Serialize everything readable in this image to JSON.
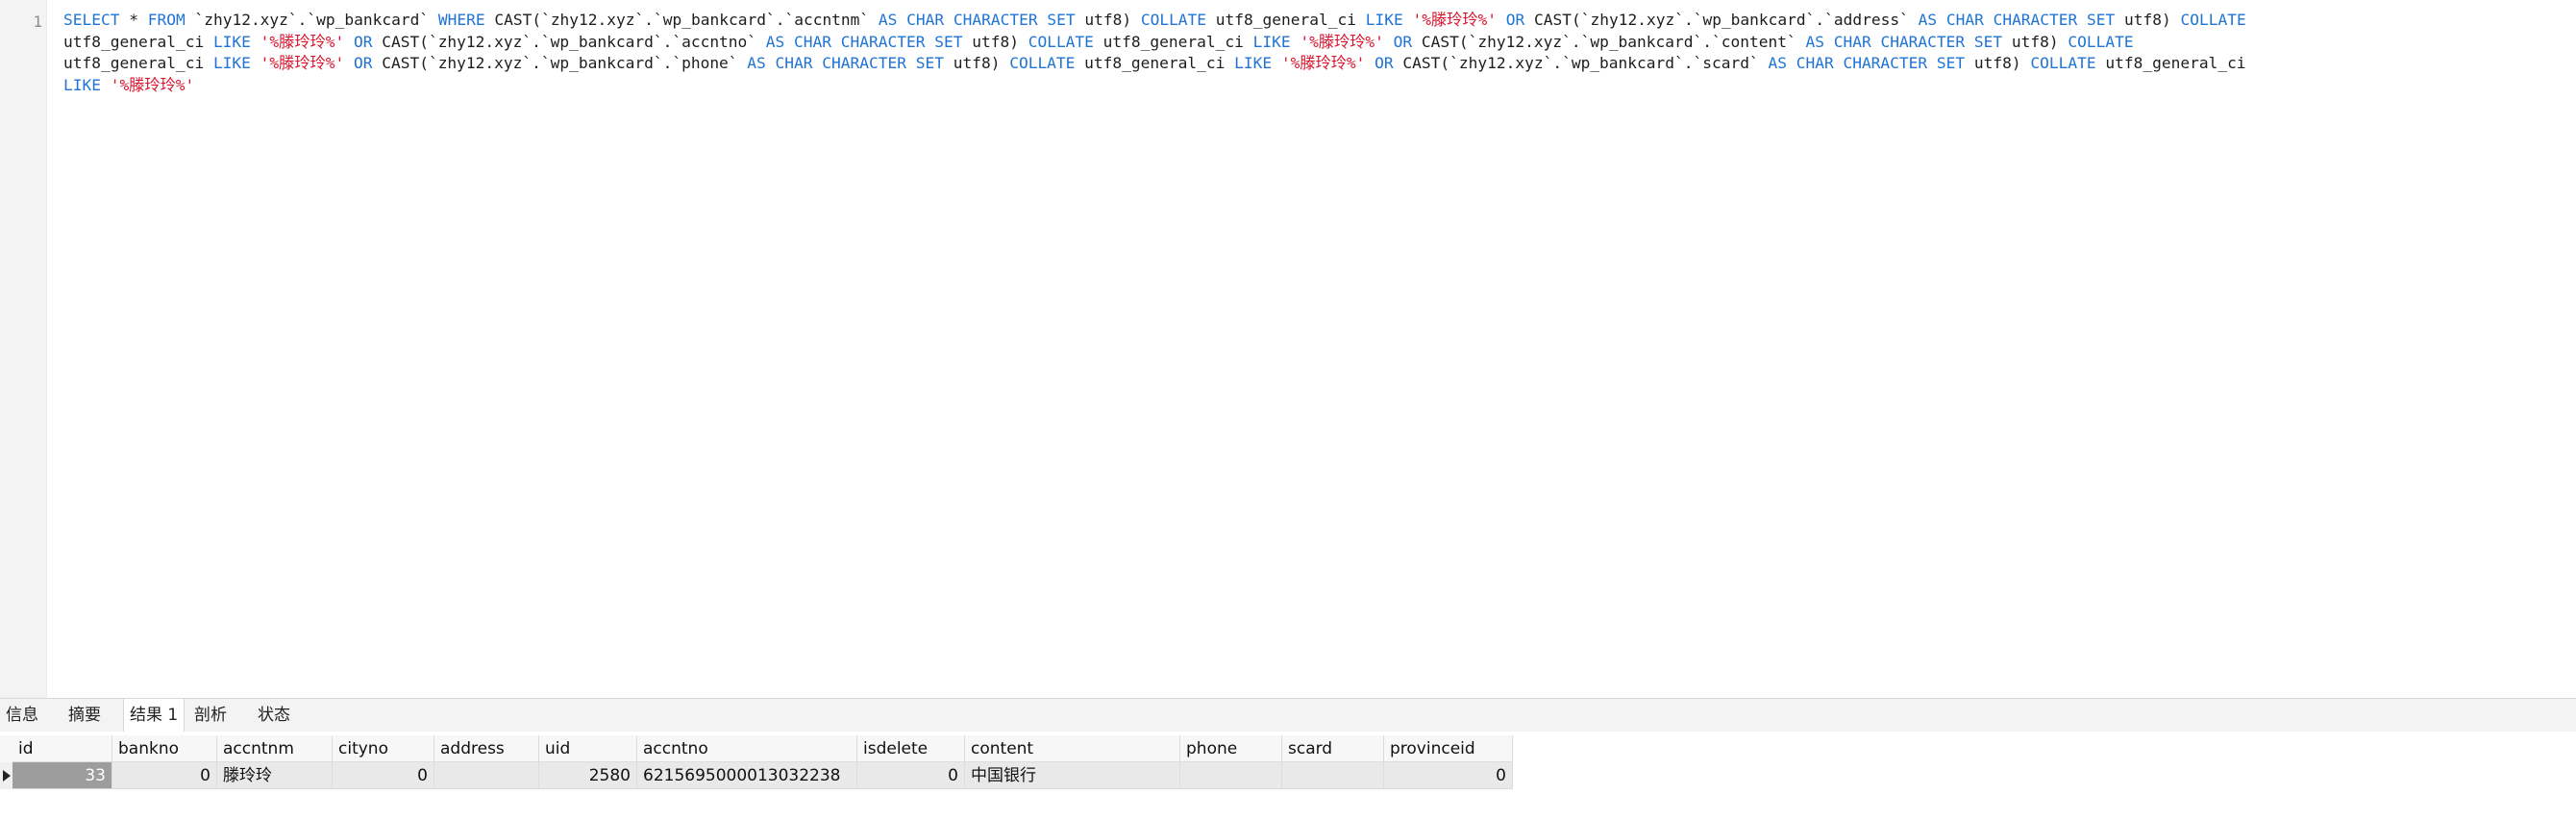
{
  "editor": {
    "line_number": "1",
    "sql_lines": [
      [
        {
          "t": "kw",
          "v": "SELECT"
        },
        {
          "t": "id",
          "v": " * "
        },
        {
          "t": "kw",
          "v": "FROM"
        },
        {
          "t": "id",
          "v": " `zhy12.xyz`.`wp_bankcard` "
        },
        {
          "t": "kw",
          "v": "WHERE"
        },
        {
          "t": "id",
          "v": " CAST(`zhy12.xyz`.`wp_bankcard`.`accntnm` "
        },
        {
          "t": "kw",
          "v": "AS CHAR CHARACTER SET"
        },
        {
          "t": "id",
          "v": " utf8) "
        },
        {
          "t": "kw",
          "v": "COLLATE"
        },
        {
          "t": "id",
          "v": " utf8_general_ci "
        },
        {
          "t": "kw",
          "v": "LIKE"
        },
        {
          "t": "id",
          "v": " "
        },
        {
          "t": "str",
          "v": "'%滕玲玲%'"
        },
        {
          "t": "id",
          "v": " "
        },
        {
          "t": "kw",
          "v": "OR"
        },
        {
          "t": "id",
          "v": " CAST(`zhy12.xyz`.`wp_bankcard`.`address` "
        },
        {
          "t": "kw",
          "v": "AS CHAR CHARACTER SET"
        },
        {
          "t": "id",
          "v": " utf8) "
        },
        {
          "t": "kw",
          "v": "COLLATE"
        }
      ],
      [
        {
          "t": "id",
          "v": "utf8_general_ci "
        },
        {
          "t": "kw",
          "v": "LIKE"
        },
        {
          "t": "id",
          "v": " "
        },
        {
          "t": "str",
          "v": "'%滕玲玲%'"
        },
        {
          "t": "id",
          "v": " "
        },
        {
          "t": "kw",
          "v": "OR"
        },
        {
          "t": "id",
          "v": " CAST(`zhy12.xyz`.`wp_bankcard`.`accntno` "
        },
        {
          "t": "kw",
          "v": "AS CHAR CHARACTER SET"
        },
        {
          "t": "id",
          "v": " utf8) "
        },
        {
          "t": "kw",
          "v": "COLLATE"
        },
        {
          "t": "id",
          "v": " utf8_general_ci "
        },
        {
          "t": "kw",
          "v": "LIKE"
        },
        {
          "t": "id",
          "v": " "
        },
        {
          "t": "str",
          "v": "'%滕玲玲%'"
        },
        {
          "t": "id",
          "v": " "
        },
        {
          "t": "kw",
          "v": "OR"
        },
        {
          "t": "id",
          "v": " CAST(`zhy12.xyz`.`wp_bankcard`.`content` "
        },
        {
          "t": "kw",
          "v": "AS CHAR CHARACTER SET"
        },
        {
          "t": "id",
          "v": " utf8) "
        },
        {
          "t": "kw",
          "v": "COLLATE"
        }
      ],
      [
        {
          "t": "id",
          "v": "utf8_general_ci "
        },
        {
          "t": "kw",
          "v": "LIKE"
        },
        {
          "t": "id",
          "v": " "
        },
        {
          "t": "str",
          "v": "'%滕玲玲%'"
        },
        {
          "t": "id",
          "v": " "
        },
        {
          "t": "kw",
          "v": "OR"
        },
        {
          "t": "id",
          "v": " CAST(`zhy12.xyz`.`wp_bankcard`.`phone` "
        },
        {
          "t": "kw",
          "v": "AS CHAR CHARACTER SET"
        },
        {
          "t": "id",
          "v": " utf8) "
        },
        {
          "t": "kw",
          "v": "COLLATE"
        },
        {
          "t": "id",
          "v": " utf8_general_ci "
        },
        {
          "t": "kw",
          "v": "LIKE"
        },
        {
          "t": "id",
          "v": " "
        },
        {
          "t": "str",
          "v": "'%滕玲玲%'"
        },
        {
          "t": "id",
          "v": " "
        },
        {
          "t": "kw",
          "v": "OR"
        },
        {
          "t": "id",
          "v": " CAST(`zhy12.xyz`.`wp_bankcard`.`scard` "
        },
        {
          "t": "kw",
          "v": "AS CHAR CHARACTER SET"
        },
        {
          "t": "id",
          "v": " utf8) "
        },
        {
          "t": "kw",
          "v": "COLLATE"
        },
        {
          "t": "id",
          "v": " utf8_general_ci"
        }
      ],
      [
        {
          "t": "kw",
          "v": "LIKE"
        },
        {
          "t": "id",
          "v": " "
        },
        {
          "t": "str",
          "v": "'%滕玲玲%'"
        }
      ]
    ],
    "colors": {
      "keyword": "#1f74d6",
      "string": "#d9152d",
      "text": "#1e1e1e"
    }
  },
  "tabs": [
    {
      "label": "信息",
      "active": false
    },
    {
      "label": "摘要",
      "active": false
    },
    {
      "label": "结果 1",
      "active": true
    },
    {
      "label": "剖析",
      "active": false
    },
    {
      "label": "状态",
      "active": false
    }
  ],
  "result": {
    "columns": [
      "id",
      "bankno",
      "accntnm",
      "cityno",
      "address",
      "uid",
      "accntno",
      "isdelete",
      "content",
      "phone",
      "scard",
      "provinceid"
    ],
    "rows": [
      [
        "33",
        "0",
        "滕玲玲",
        "0",
        "",
        "2580",
        "6215695000013032238",
        "0",
        "中国银行",
        "",
        "",
        "0"
      ]
    ]
  }
}
